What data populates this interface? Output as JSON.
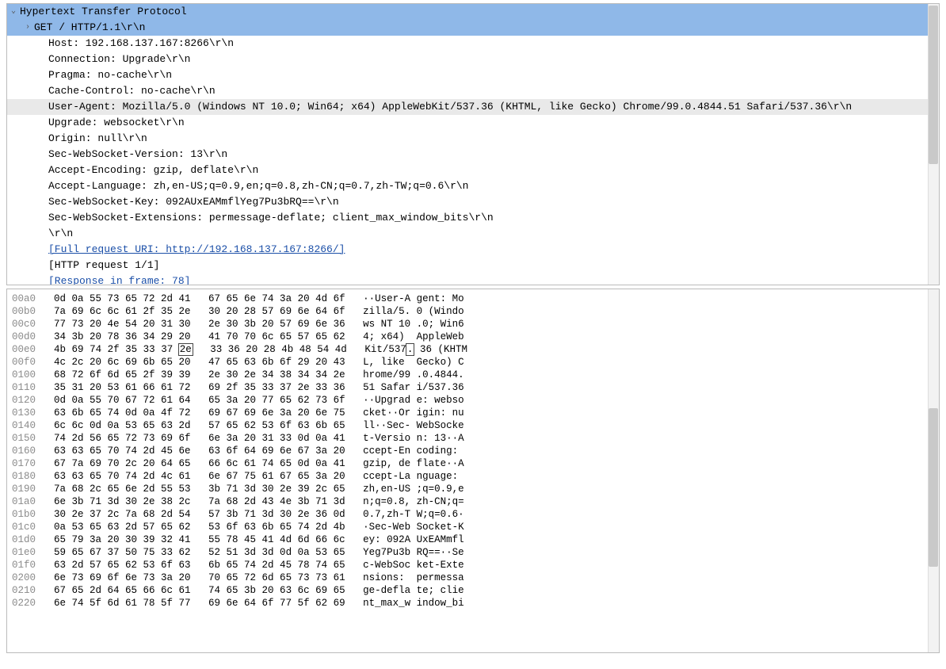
{
  "protocol_tree": {
    "title": "Hypertext Transfer Protocol",
    "request_line": "GET / HTTP/1.1\\r\\n",
    "headers": [
      {
        "text": "Host: 192.168.137.167:8266\\r\\n",
        "hl": false
      },
      {
        "text": "Connection: Upgrade\\r\\n",
        "hl": false
      },
      {
        "text": "Pragma: no-cache\\r\\n",
        "hl": false
      },
      {
        "text": "Cache-Control: no-cache\\r\\n",
        "hl": false
      },
      {
        "text": "User-Agent: Mozilla/5.0 (Windows NT 10.0; Win64; x64) AppleWebKit/537.36 (KHTML, like Gecko) Chrome/99.0.4844.51 Safari/537.36\\r\\n",
        "hl": true
      },
      {
        "text": "Upgrade: websocket\\r\\n",
        "hl": false
      },
      {
        "text": "Origin: null\\r\\n",
        "hl": false
      },
      {
        "text": "Sec-WebSocket-Version: 13\\r\\n",
        "hl": false
      },
      {
        "text": "Accept-Encoding: gzip, deflate\\r\\n",
        "hl": false
      },
      {
        "text": "Accept-Language: zh,en-US;q=0.9,en;q=0.8,zh-CN;q=0.7,zh-TW;q=0.6\\r\\n",
        "hl": false
      },
      {
        "text": "Sec-WebSocket-Key: 092AUxEAMmflYeg7Pu3bRQ==\\r\\n",
        "hl": false
      },
      {
        "text": "Sec-WebSocket-Extensions: permessage-deflate; client_max_window_bits\\r\\n",
        "hl": false
      },
      {
        "text": "\\r\\n",
        "hl": false
      }
    ],
    "full_uri": "[Full request URI: http://192.168.137.167:8266/]",
    "request_count": "[HTTP request 1/1]",
    "response_frame": "[Response in frame: 78]"
  },
  "hex_dump": {
    "marked_offset": "00e0",
    "marked_col": 7,
    "lines": [
      {
        "off": "00a0",
        "h1": "0d 0a 55 73 65 72 2d 41",
        "h2": "67 65 6e 74 3a 20 4d 6f",
        "a1": "··User-A",
        "a2": "gent: Mo"
      },
      {
        "off": "00b0",
        "h1": "7a 69 6c 6c 61 2f 35 2e",
        "h2": "30 20 28 57 69 6e 64 6f",
        "a1": "zilla/5.",
        "a2": "0 (Windo"
      },
      {
        "off": "00c0",
        "h1": "77 73 20 4e 54 20 31 30",
        "h2": "2e 30 3b 20 57 69 6e 36",
        "a1": "ws NT 10",
        "a2": ".0; Win6"
      },
      {
        "off": "00d0",
        "h1": "34 3b 20 78 36 34 29 20",
        "h2": "41 70 70 6c 65 57 65 62",
        "a1": "4; x64) ",
        "a2": "AppleWeb"
      },
      {
        "off": "00e0",
        "h1": "4b 69 74 2f 35 33 37 2e",
        "h2": "33 36 20 28 4b 48 54 4d",
        "a1": "Kit/537.",
        "a2": "36 (KHTM"
      },
      {
        "off": "00f0",
        "h1": "4c 2c 20 6c 69 6b 65 20",
        "h2": "47 65 63 6b 6f 29 20 43",
        "a1": "L, like ",
        "a2": "Gecko) C"
      },
      {
        "off": "0100",
        "h1": "68 72 6f 6d 65 2f 39 39",
        "h2": "2e 30 2e 34 38 34 34 2e",
        "a1": "hrome/99",
        "a2": ".0.4844."
      },
      {
        "off": "0110",
        "h1": "35 31 20 53 61 66 61 72",
        "h2": "69 2f 35 33 37 2e 33 36",
        "a1": "51 Safar",
        "a2": "i/537.36"
      },
      {
        "off": "0120",
        "h1": "0d 0a 55 70 67 72 61 64",
        "h2": "65 3a 20 77 65 62 73 6f",
        "a1": "··Upgrad",
        "a2": "e: webso"
      },
      {
        "off": "0130",
        "h1": "63 6b 65 74 0d 0a 4f 72",
        "h2": "69 67 69 6e 3a 20 6e 75",
        "a1": "cket··Or",
        "a2": "igin: nu"
      },
      {
        "off": "0140",
        "h1": "6c 6c 0d 0a 53 65 63 2d",
        "h2": "57 65 62 53 6f 63 6b 65",
        "a1": "ll··Sec-",
        "a2": "WebSocke"
      },
      {
        "off": "0150",
        "h1": "74 2d 56 65 72 73 69 6f",
        "h2": "6e 3a 20 31 33 0d 0a 41",
        "a1": "t-Versio",
        "a2": "n: 13··A"
      },
      {
        "off": "0160",
        "h1": "63 63 65 70 74 2d 45 6e",
        "h2": "63 6f 64 69 6e 67 3a 20",
        "a1": "ccept-En",
        "a2": "coding: "
      },
      {
        "off": "0170",
        "h1": "67 7a 69 70 2c 20 64 65",
        "h2": "66 6c 61 74 65 0d 0a 41",
        "a1": "gzip, de",
        "a2": "flate··A"
      },
      {
        "off": "0180",
        "h1": "63 63 65 70 74 2d 4c 61",
        "h2": "6e 67 75 61 67 65 3a 20",
        "a1": "ccept-La",
        "a2": "nguage: "
      },
      {
        "off": "0190",
        "h1": "7a 68 2c 65 6e 2d 55 53",
        "h2": "3b 71 3d 30 2e 39 2c 65",
        "a1": "zh,en-US",
        "a2": ";q=0.9,e"
      },
      {
        "off": "01a0",
        "h1": "6e 3b 71 3d 30 2e 38 2c",
        "h2": "7a 68 2d 43 4e 3b 71 3d",
        "a1": "n;q=0.8,",
        "a2": "zh-CN;q="
      },
      {
        "off": "01b0",
        "h1": "30 2e 37 2c 7a 68 2d 54",
        "h2": "57 3b 71 3d 30 2e 36 0d",
        "a1": "0.7,zh-T",
        "a2": "W;q=0.6·"
      },
      {
        "off": "01c0",
        "h1": "0a 53 65 63 2d 57 65 62",
        "h2": "53 6f 63 6b 65 74 2d 4b",
        "a1": "·Sec-Web",
        "a2": "Socket-K"
      },
      {
        "off": "01d0",
        "h1": "65 79 3a 20 30 39 32 41",
        "h2": "55 78 45 41 4d 6d 66 6c",
        "a1": "ey: 092A",
        "a2": "UxEAMmfl"
      },
      {
        "off": "01e0",
        "h1": "59 65 67 37 50 75 33 62",
        "h2": "52 51 3d 3d 0d 0a 53 65",
        "a1": "Yeg7Pu3b",
        "a2": "RQ==··Se"
      },
      {
        "off": "01f0",
        "h1": "63 2d 57 65 62 53 6f 63",
        "h2": "6b 65 74 2d 45 78 74 65",
        "a1": "c-WebSoc",
        "a2": "ket-Exte"
      },
      {
        "off": "0200",
        "h1": "6e 73 69 6f 6e 73 3a 20",
        "h2": "70 65 72 6d 65 73 73 61",
        "a1": "nsions: ",
        "a2": "permessa"
      },
      {
        "off": "0210",
        "h1": "67 65 2d 64 65 66 6c 61",
        "h2": "74 65 3b 20 63 6c 69 65",
        "a1": "ge-defla",
        "a2": "te; clie"
      },
      {
        "off": "0220",
        "h1": "6e 74 5f 6d 61 78 5f 77",
        "h2": "69 6e 64 6f 77 5f 62 69",
        "a1": "nt_max_w",
        "a2": "indow_bi"
      }
    ]
  }
}
